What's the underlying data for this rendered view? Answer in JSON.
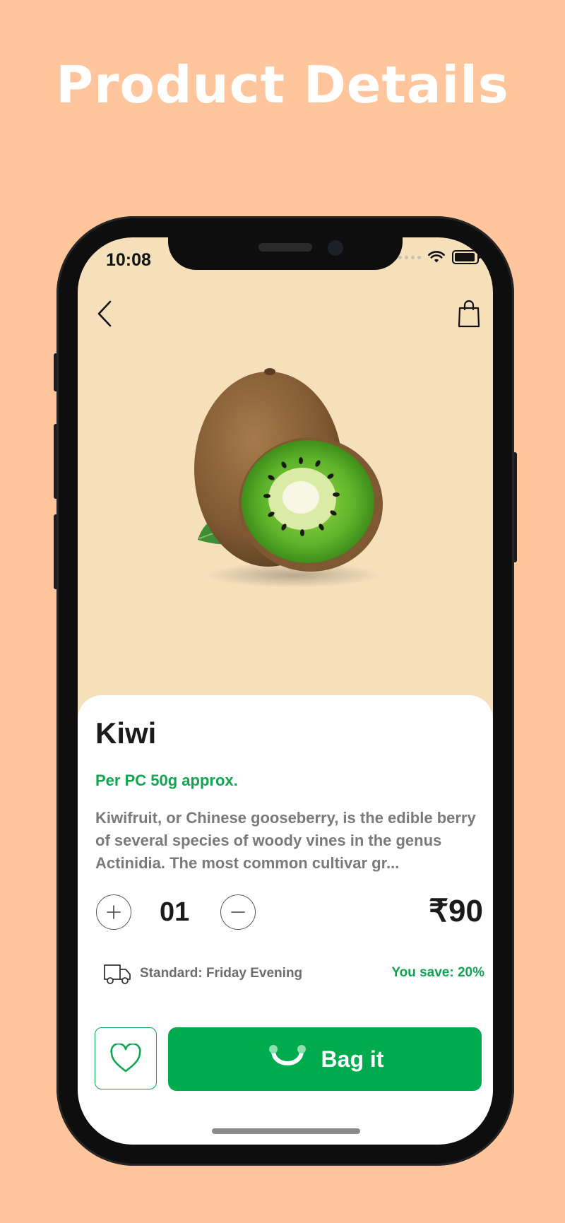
{
  "headline": "Product Details",
  "status_bar": {
    "time": "10:08"
  },
  "header": {
    "back_icon": "chevron-left-icon",
    "bag_icon": "shopping-bag-icon"
  },
  "product": {
    "name": "Kiwi",
    "weight_note": "Per PC 50g approx.",
    "description": "Kiwifruit, or Chinese gooseberry, is the edible berry of several species of woody vines in the genus Actinidia. The most common cultivar gr...",
    "quantity": "01",
    "price": "₹90",
    "delivery": "Standard: Friday Evening",
    "savings": "You save: 20%"
  },
  "actions": {
    "add_to_bag_label": "Bag it",
    "favorite_icon": "heart-icon"
  },
  "colors": {
    "background": "#FFC69D",
    "hero_background": "#F6E0BC",
    "accent": "#00AB4E",
    "accent_text": "#0EA64F"
  }
}
